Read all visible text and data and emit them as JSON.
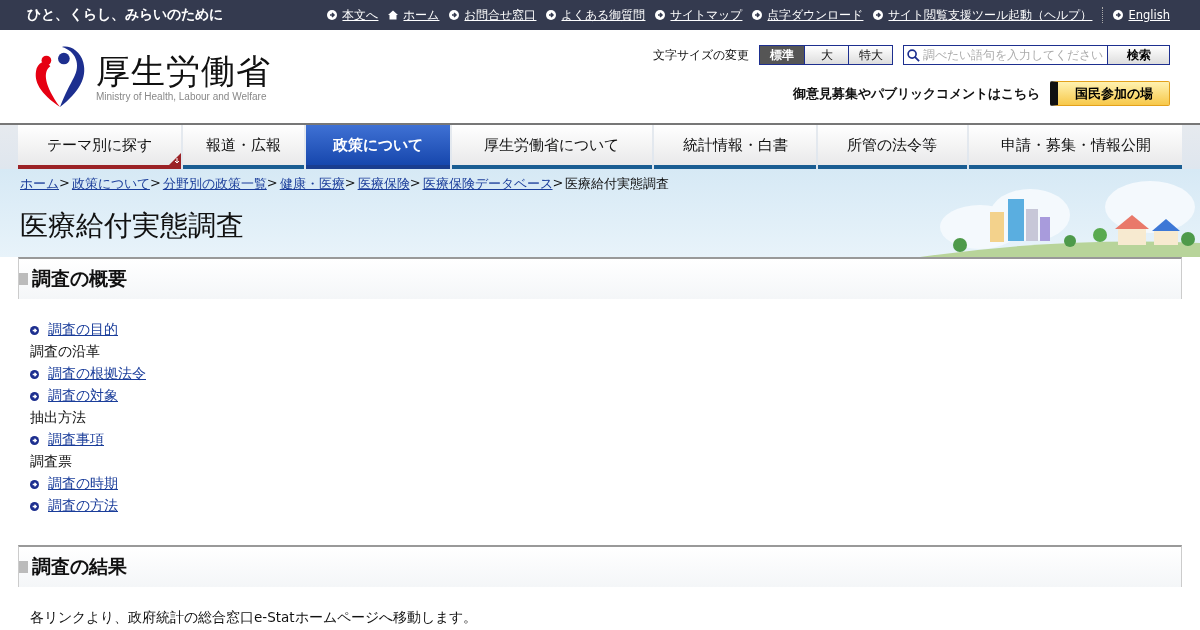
{
  "top_bar": {
    "tagline": "ひと、くらし、みらいのために",
    "links": [
      {
        "label": "本文へ",
        "kind": "link"
      },
      {
        "label": "ホーム",
        "kind": "home"
      },
      {
        "label": "お問合せ窓口",
        "kind": "link"
      },
      {
        "label": "よくある御質問",
        "kind": "link"
      },
      {
        "label": "サイトマップ",
        "kind": "link"
      },
      {
        "label": "点字ダウンロード",
        "kind": "link"
      },
      {
        "label": "サイト閲覧支援ツール起動（ヘルプ）",
        "kind": "link"
      }
    ],
    "language_link": "English"
  },
  "header": {
    "logo_title": "厚生労働省",
    "logo_subtitle": "Ministry of Health, Labour and Welfare",
    "font_size_label": "文字サイズの変更",
    "font_sizes": [
      {
        "label": "標準",
        "selected": true
      },
      {
        "label": "大",
        "selected": false
      },
      {
        "label": "特大",
        "selected": false
      }
    ],
    "search": {
      "placeholder": "調べたい語句を入力してください",
      "button": "検索"
    },
    "comment_text": "御意見募集やパブリックコメントはこちら",
    "participation_button": "国民参加の場"
  },
  "nav": [
    {
      "label": "テーマ別に探す",
      "selected": false,
      "has_menu": true
    },
    {
      "label": "報道・広報",
      "selected": false,
      "has_menu": false
    },
    {
      "label": "政策について",
      "selected": true,
      "has_menu": false
    },
    {
      "label": "厚生労働省について",
      "selected": false,
      "has_menu": false
    },
    {
      "label": "統計情報・白書",
      "selected": false,
      "has_menu": false
    },
    {
      "label": "所管の法令等",
      "selected": false,
      "has_menu": false
    },
    {
      "label": "申請・募集・情報公開",
      "selected": false,
      "has_menu": false
    }
  ],
  "breadcrumb": {
    "separator": ">",
    "links": [
      "ホーム",
      "政策について",
      "分野別の政策一覧",
      "健康・医療",
      "医療保険",
      "医療保険データベース"
    ],
    "current": "医療給付実態調査"
  },
  "page_title": "医療給付実態調査",
  "sections": [
    {
      "heading": "調査の概要",
      "items": [
        {
          "label": "調査の目的",
          "kind": "link"
        },
        {
          "label": "調査の沿革",
          "kind": "text"
        },
        {
          "label": "調査の根拠法令",
          "kind": "link"
        },
        {
          "label": "調査の対象",
          "kind": "link"
        },
        {
          "label": "抽出方法",
          "kind": "text"
        },
        {
          "label": "調査事項",
          "kind": "link"
        },
        {
          "label": "調査票",
          "kind": "text"
        },
        {
          "label": "調査の時期",
          "kind": "link"
        },
        {
          "label": "調査の方法",
          "kind": "link"
        }
      ]
    },
    {
      "heading": "調査の結果",
      "items": [
        {
          "label": "各リンクより、政府統計の総合窓口e-Statホームページへ移動します。",
          "kind": "text"
        }
      ]
    }
  ]
}
